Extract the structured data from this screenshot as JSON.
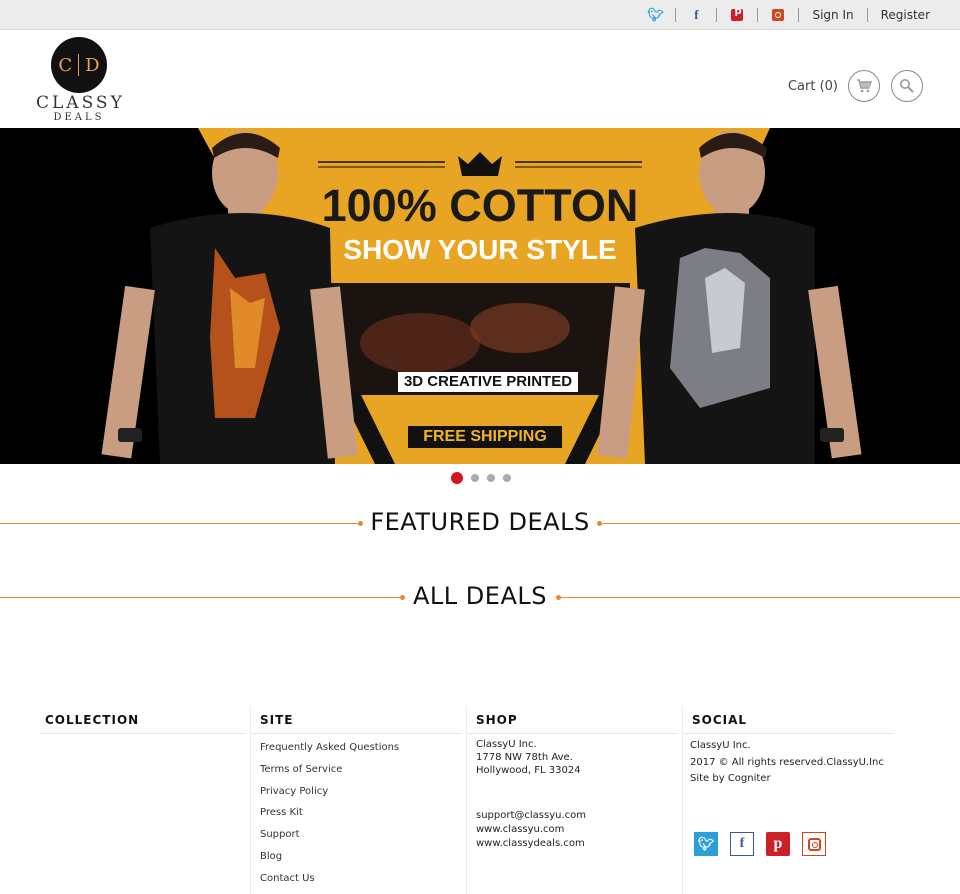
{
  "topbar": {
    "social": [
      "twitter-icon",
      "facebook-icon",
      "pinterest-icon",
      "instagram-icon"
    ],
    "sign_in": "Sign In",
    "register": "Register"
  },
  "header": {
    "logo": {
      "initial_left": "C",
      "initial_right": "D",
      "line1": "CLASSY",
      "line2": "DEALS"
    },
    "cart_label": "Cart (0)",
    "cart_icon": "cart-icon",
    "search_icon": "search-icon"
  },
  "banner": {
    "title": "100% COTTON",
    "subtitle": "SHOW YOUR STYLE",
    "tag": "3D CREATIVE PRINTED",
    "cta": "FREE SHIPPING",
    "slides": 4,
    "active_slide": 1
  },
  "sections": {
    "featured": "FEATURED DEALS",
    "all": "ALL DEALS"
  },
  "footer": {
    "collection": {
      "heading": "COLLECTION"
    },
    "site": {
      "heading": "SITE",
      "links": [
        "Frequently Asked Questions",
        "Terms of Service",
        "Privacy Policy",
        "Press Kit",
        "Support",
        "Blog",
        "Contact Us"
      ]
    },
    "shop": {
      "heading": "SHOP",
      "address": [
        "ClassyU Inc.",
        "1778 NW 78th Ave.",
        "Hollywood, FL 33024"
      ],
      "contact": [
        "support@classyu.com",
        "www.classyu.com",
        "www.classydeals.com"
      ]
    },
    "social": {
      "heading": "SOCIAL",
      "lines": [
        "ClassyU Inc.",
        "2017 © All rights reserved.ClassyU.Inc",
        "Site by Cogniter"
      ],
      "icons": [
        "twitter-icon",
        "facebook-icon",
        "pinterest-icon",
        "instagram-icon"
      ]
    }
  },
  "colors": {
    "accent": "#e0893b",
    "banner_yellow": "#e8a523",
    "active_dot": "#d3151c",
    "twitter": "#2a9fd8",
    "facebook": "#3b5998",
    "pinterest": "#cb2027",
    "instagram": "#d0461f"
  }
}
